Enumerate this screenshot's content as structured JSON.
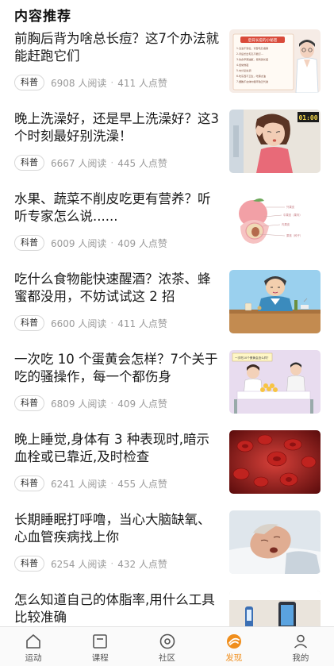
{
  "section_title": "内容推荐",
  "articles": [
    {
      "title": "前胸后背为啥总长痘？这7个办法就能赶跑它们",
      "tag": "科普",
      "reads": "6908 人阅读",
      "likes": "411 人点赞"
    },
    {
      "title": "晚上洗澡好，还是早上洗澡好？这3个时刻最好别洗澡！",
      "tag": "科普",
      "reads": "6667 人阅读",
      "likes": "445 人点赞"
    },
    {
      "title": "水果、蔬菜不削皮吃更有营养？听听专家怎么说......",
      "tag": "科普",
      "reads": "6009 人阅读",
      "likes": "409 人点赞"
    },
    {
      "title": "吃什么食物能快速醒酒？浓茶、蜂蜜都没用，不妨试试这 2 招",
      "tag": "科普",
      "reads": "6600 人阅读",
      "likes": "411 人点赞"
    },
    {
      "title": "一次吃 10 个蛋黄会怎样？7个关于吃的骚操作，每一个都伤身",
      "tag": "科普",
      "reads": "6809 人阅读",
      "likes": "409 人点赞"
    },
    {
      "title": "晚上睡觉,身体有 3 种表现时,暗示血栓或已靠近,及时检查",
      "tag": "科普",
      "reads": "6241 人阅读",
      "likes": "455 人点赞"
    },
    {
      "title": "长期睡眠打呼噜，当心大脑缺氧、心血管疾病找上你",
      "tag": "科普",
      "reads": "6254 人阅读",
      "likes": "432 人点赞"
    },
    {
      "title": "怎么知道自己的体脂率,用什么工具比较准确",
      "tag": "",
      "reads": "",
      "likes": ""
    }
  ],
  "thumbs": {
    "t1_heading": "后背长痘的小秘密",
    "t1_lines": [
      "1.清洁不到位，背部毛孔堵塞",
      "2.背后长出毛孔不能打...",
      "3.饮食辛辣油腻，易刺激长痘",
      "4.经常熬夜",
      "5.内分泌失调",
      "6.吃东西不卫生，吃辣太油",
      "7.细胞不在体内循环缺乏代谢"
    ],
    "t2_clock": "01:00",
    "t3_labels": [
      "外果皮",
      "中果皮（果肉）",
      "内果皮",
      "果核（种子）"
    ],
    "t5_heading": "一次吃10个蛋黄会怎么样？"
  },
  "tabbar": [
    {
      "label": "运动",
      "icon": "home-icon",
      "active": false
    },
    {
      "label": "课程",
      "icon": "course-icon",
      "active": false
    },
    {
      "label": "社区",
      "icon": "community-icon",
      "active": false
    },
    {
      "label": "发现",
      "icon": "discover-icon",
      "active": true
    },
    {
      "label": "我的",
      "icon": "profile-icon",
      "active": false
    }
  ],
  "colors": {
    "accent": "#f08e1c",
    "tab_inactive": "#555555",
    "meta": "#999999"
  }
}
